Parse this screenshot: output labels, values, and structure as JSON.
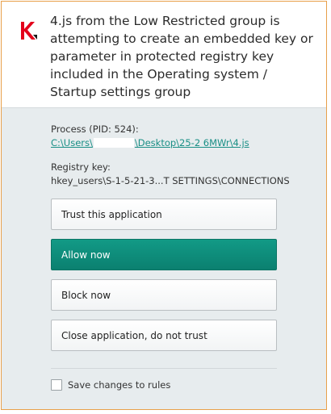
{
  "colors": {
    "accent": "#0e8a79",
    "link": "#1a8f86",
    "logo": "#e3001b",
    "window_border": "#e8a04a"
  },
  "logo": {
    "icon": "kaspersky-k-logo"
  },
  "header": {
    "message": "4.js from the Low Restricted group is attempting to create an embedded key or parameter in protected registry key included in the Operating system / Startup settings group"
  },
  "process": {
    "label": "Process (PID: 524):",
    "path_prefix": "C:\\Users\\",
    "path_suffix": "\\Desktop\\25-2 6MWr\\4.js"
  },
  "registry": {
    "label": "Registry key:",
    "value": "hkey_users\\S-1-5-21-3...T SETTINGS\\CONNECTIONS"
  },
  "actions": {
    "trust": "Trust this application",
    "allow": "Allow now",
    "block": "Block now",
    "close": "Close application, do not trust"
  },
  "options": {
    "save_rules_label": "Save changes to rules",
    "save_rules_checked": false
  }
}
